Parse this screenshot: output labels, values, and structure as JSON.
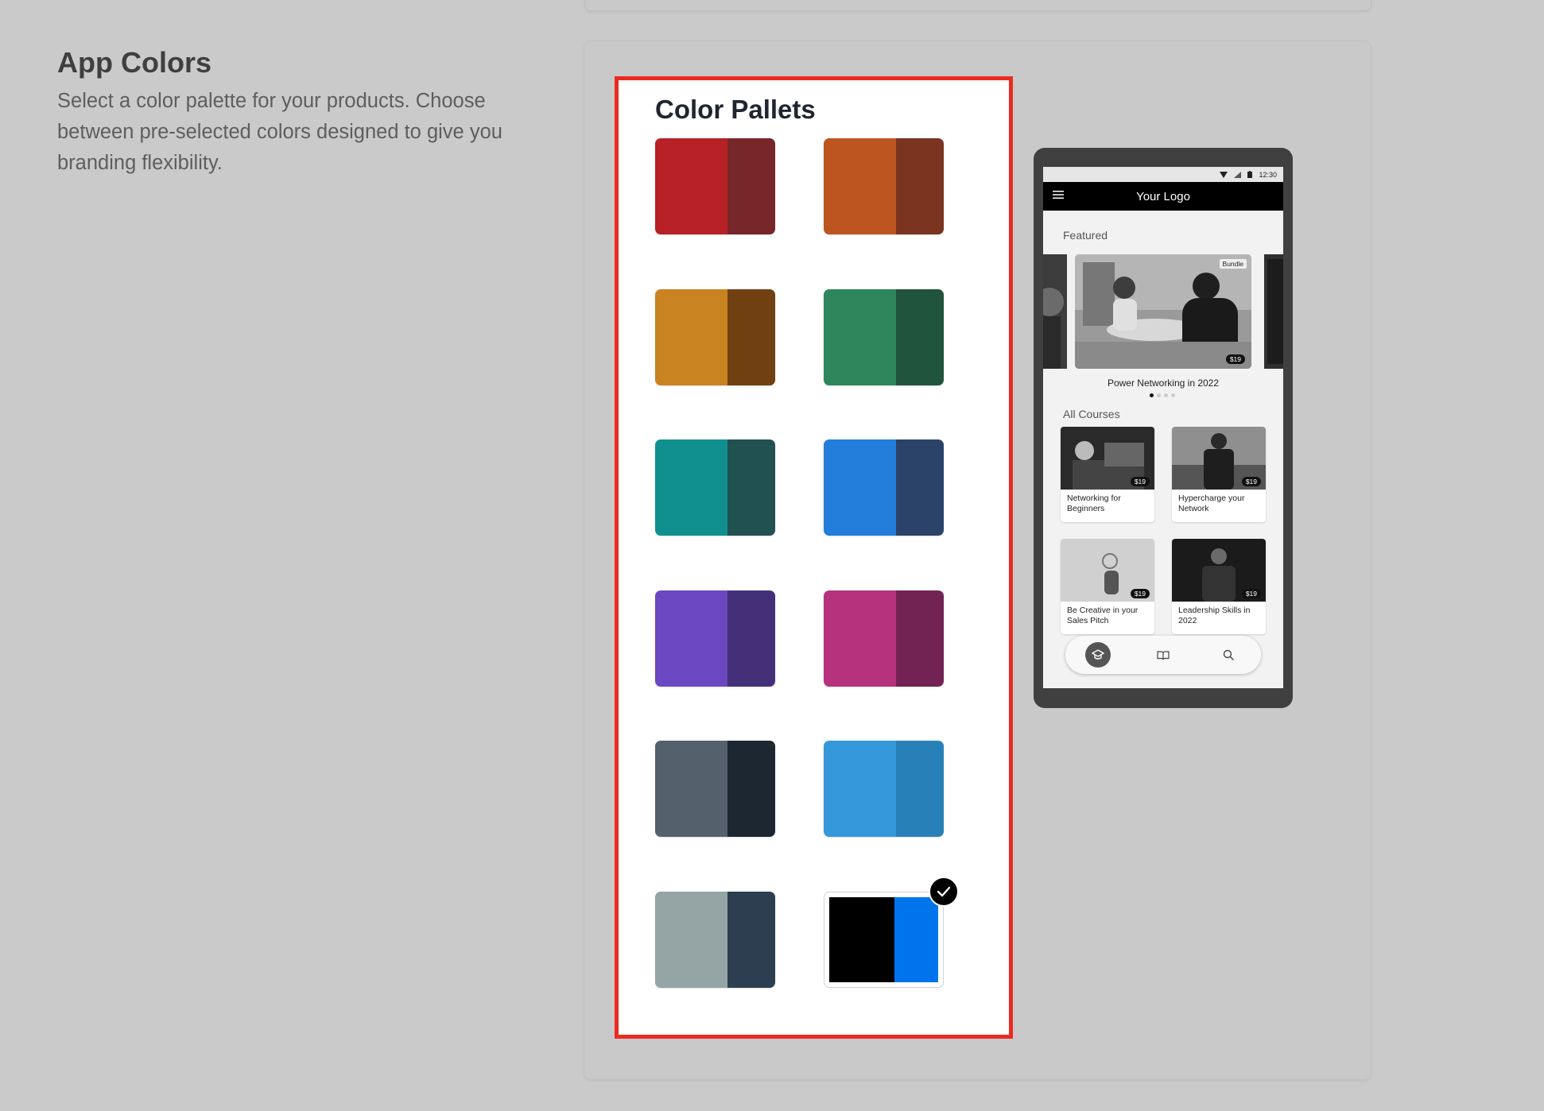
{
  "section": {
    "title": "App Colors",
    "description": "Select a color palette for your products. Choose between pre-selected colors designed to give you branding flexibility."
  },
  "palettes": {
    "title": "Color Pallets",
    "items": [
      {
        "primary": "#b72025",
        "secondary": "#77262a"
      },
      {
        "primary": "#bd5521",
        "secondary": "#7b3420"
      },
      {
        "primary": "#c98321",
        "secondary": "#714011"
      },
      {
        "primary": "#2e865c",
        "secondary": "#20543c"
      },
      {
        "primary": "#0f908f",
        "secondary": "#225152"
      },
      {
        "primary": "#227ddb",
        "secondary": "#2b4369"
      },
      {
        "primary": "#6b47c1",
        "secondary": "#443079"
      },
      {
        "primary": "#b6327c",
        "secondary": "#732254"
      },
      {
        "primary": "#54606c",
        "secondary": "#1d2731"
      },
      {
        "primary": "#3498db",
        "secondary": "#2880b9"
      },
      {
        "primary": "#95a5a6",
        "secondary": "#2c3e50"
      },
      {
        "primary": "#000000",
        "secondary": "#0074ec",
        "selected": true
      }
    ],
    "selected_icon": "checkmark-icon"
  },
  "phone_preview": {
    "status_time": "12:30",
    "logo": "Your Logo",
    "featured_label": "Featured",
    "featured": {
      "title": "Power Networking in 2022",
      "badge": "Bundle",
      "price": "$19"
    },
    "all_courses_label": "All Courses",
    "courses": [
      {
        "title": "Networking for Beginners",
        "price": "$19"
      },
      {
        "title": "Hypercharge your Network",
        "price": "$19"
      },
      {
        "title": "Be Creative in your Sales Pitch",
        "price": "$19"
      },
      {
        "title": "Leadership Skills in 2022",
        "price": "$19"
      }
    ],
    "nav_icons": [
      "graduation-cap-icon",
      "book-icon",
      "search-icon"
    ]
  }
}
